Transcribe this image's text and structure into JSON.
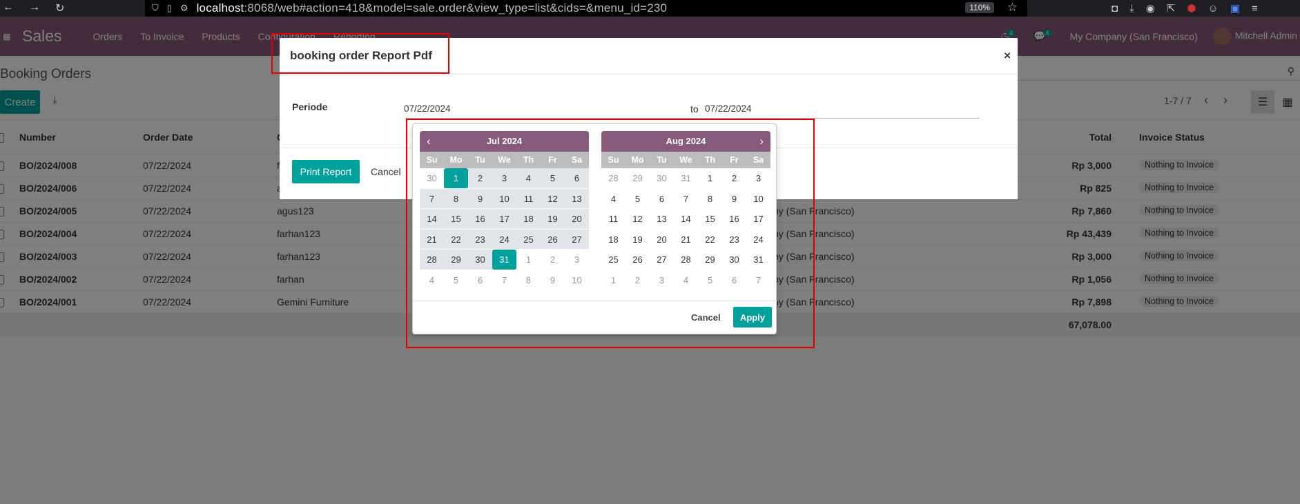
{
  "browser": {
    "url_host": "localhost",
    "url_path": ":8068/web#action=418&model=sale.order&view_type=list&cids=&menu_id=230",
    "zoom": "110%"
  },
  "navbar": {
    "app_name": "Sales",
    "menu": [
      "Orders",
      "To Invoice",
      "Products",
      "Configuration",
      "Reporting"
    ],
    "activity_count": "4",
    "message_count": "4",
    "company": "My Company (San Francisco)",
    "user": "Mitchell Admin"
  },
  "control_panel": {
    "breadcrumb": "Booking Orders",
    "create_label": "Create",
    "pager": "1-7 / 7"
  },
  "table": {
    "headers": {
      "number": "Number",
      "order_date": "Order Date",
      "total": "Total",
      "invoice_status": "Invoice Status"
    },
    "rows": [
      {
        "number": "BO/2024/008",
        "date": "07/22/2024",
        "customer": "f",
        "company": "",
        "total": "Rp 3,000",
        "status": "Nothing to Invoice"
      },
      {
        "number": "BO/2024/006",
        "date": "07/22/2024",
        "customer": "a",
        "company": "",
        "total": "Rp 825",
        "status": "Nothing to Invoice"
      },
      {
        "number": "BO/2024/005",
        "date": "07/22/2024",
        "customer": "agus123",
        "company": "ny (San Francisco)",
        "total": "Rp 7,860",
        "status": "Nothing to Invoice"
      },
      {
        "number": "BO/2024/004",
        "date": "07/22/2024",
        "customer": "farhan123",
        "company": "ny (San Francisco)",
        "total": "Rp 43,439",
        "status": "Nothing to Invoice"
      },
      {
        "number": "BO/2024/003",
        "date": "07/22/2024",
        "customer": "farhan123",
        "company": "ny (San Francisco)",
        "total": "Rp 3,000",
        "status": "Nothing to Invoice"
      },
      {
        "number": "BO/2024/002",
        "date": "07/22/2024",
        "customer": "farhan",
        "company": "ny (San Francisco)",
        "total": "Rp 1,056",
        "status": "Nothing to Invoice"
      },
      {
        "number": "BO/2024/001",
        "date": "07/22/2024",
        "customer": "Gemini Furniture",
        "company": "ny (San Francisco)",
        "total": "Rp 7,898",
        "status": "Nothing to Invoice"
      }
    ],
    "footer_total": "67,078.00"
  },
  "modal": {
    "title": "booking order Report Pdf",
    "close": "×",
    "periode_label": "Periode",
    "date_from": "07/22/2024",
    "to_label": "to",
    "date_to": "07/22/2024",
    "print_label": "Print Report",
    "cancel_label": "Cancel"
  },
  "datepicker": {
    "weekdays": [
      "Su",
      "Mo",
      "Tu",
      "We",
      "Th",
      "Fr",
      "Sa"
    ],
    "left": {
      "month": "Jul 2024",
      "days": [
        {
          "d": "30",
          "off": true
        },
        {
          "d": "1",
          "sel": true
        },
        {
          "d": "2",
          "range": true
        },
        {
          "d": "3",
          "range": true
        },
        {
          "d": "4",
          "range": true
        },
        {
          "d": "5",
          "range": true
        },
        {
          "d": "6",
          "range": true
        },
        {
          "d": "7",
          "range": true
        },
        {
          "d": "8",
          "range": true
        },
        {
          "d": "9",
          "range": true
        },
        {
          "d": "10",
          "range": true
        },
        {
          "d": "11",
          "range": true
        },
        {
          "d": "12",
          "range": true
        },
        {
          "d": "13",
          "range": true
        },
        {
          "d": "14",
          "range": true
        },
        {
          "d": "15",
          "range": true
        },
        {
          "d": "16",
          "range": true
        },
        {
          "d": "17",
          "range": true
        },
        {
          "d": "18",
          "range": true
        },
        {
          "d": "19",
          "range": true
        },
        {
          "d": "20",
          "range": true
        },
        {
          "d": "21",
          "range": true
        },
        {
          "d": "22",
          "range": true
        },
        {
          "d": "23",
          "range": true
        },
        {
          "d": "24",
          "range": true
        },
        {
          "d": "25",
          "range": true
        },
        {
          "d": "26",
          "range": true
        },
        {
          "d": "27",
          "range": true
        },
        {
          "d": "28",
          "range": true
        },
        {
          "d": "29",
          "range": true
        },
        {
          "d": "30",
          "range": true
        },
        {
          "d": "31",
          "sel": true
        },
        {
          "d": "1",
          "off": true
        },
        {
          "d": "2",
          "off": true
        },
        {
          "d": "3",
          "off": true
        },
        {
          "d": "4",
          "off": true
        },
        {
          "d": "5",
          "off": true
        },
        {
          "d": "6",
          "off": true
        },
        {
          "d": "7",
          "off": true
        },
        {
          "d": "8",
          "off": true
        },
        {
          "d": "9",
          "off": true
        },
        {
          "d": "10",
          "off": true
        }
      ]
    },
    "right": {
      "month": "Aug 2024",
      "days": [
        {
          "d": "28",
          "off": true
        },
        {
          "d": "29",
          "off": true
        },
        {
          "d": "30",
          "off": true
        },
        {
          "d": "31",
          "off": true
        },
        {
          "d": "1"
        },
        {
          "d": "2"
        },
        {
          "d": "3"
        },
        {
          "d": "4"
        },
        {
          "d": "5"
        },
        {
          "d": "6"
        },
        {
          "d": "7"
        },
        {
          "d": "8"
        },
        {
          "d": "9"
        },
        {
          "d": "10"
        },
        {
          "d": "11"
        },
        {
          "d": "12"
        },
        {
          "d": "13"
        },
        {
          "d": "14"
        },
        {
          "d": "15"
        },
        {
          "d": "16"
        },
        {
          "d": "17"
        },
        {
          "d": "18"
        },
        {
          "d": "19"
        },
        {
          "d": "20"
        },
        {
          "d": "21"
        },
        {
          "d": "22"
        },
        {
          "d": "23"
        },
        {
          "d": "24"
        },
        {
          "d": "25"
        },
        {
          "d": "26"
        },
        {
          "d": "27"
        },
        {
          "d": "28"
        },
        {
          "d": "29"
        },
        {
          "d": "30"
        },
        {
          "d": "31"
        },
        {
          "d": "1",
          "off": true
        },
        {
          "d": "2",
          "off": true
        },
        {
          "d": "3",
          "off": true
        },
        {
          "d": "4",
          "off": true
        },
        {
          "d": "5",
          "off": true
        },
        {
          "d": "6",
          "off": true
        },
        {
          "d": "7",
          "off": true
        }
      ]
    },
    "cancel_label": "Cancel",
    "apply_label": "Apply"
  },
  "colors": {
    "brand": "#875a7b",
    "accent": "#00a09d",
    "annotation": "#e00000"
  }
}
